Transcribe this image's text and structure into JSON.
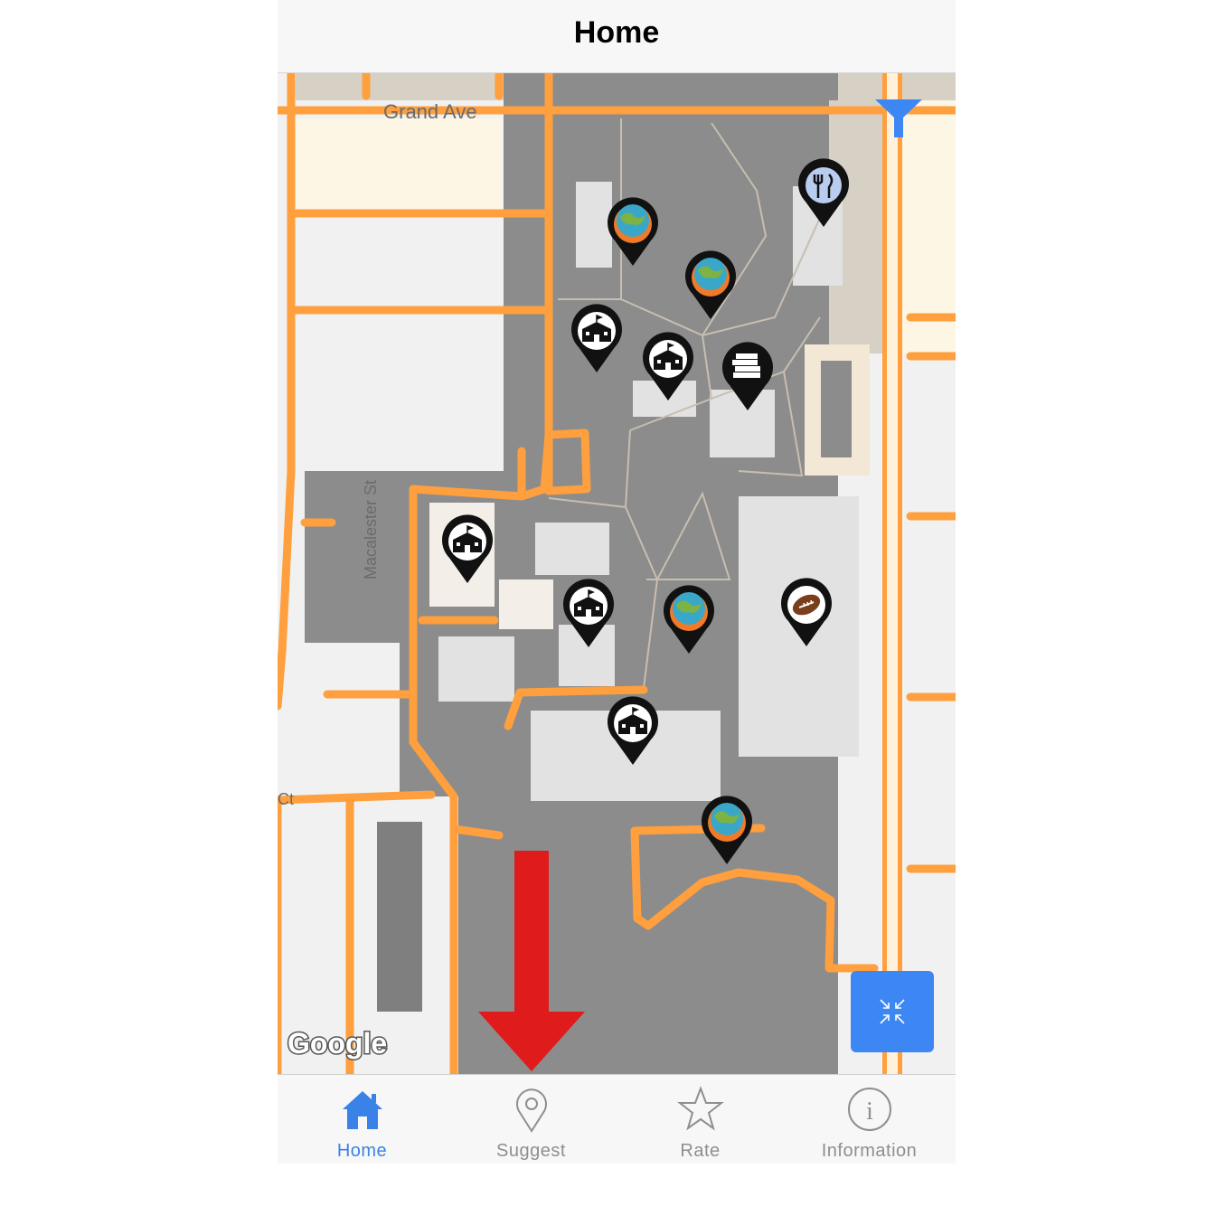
{
  "navbar": {
    "title": "Home"
  },
  "map": {
    "street_labels": {
      "grand_ave": "Grand Ave",
      "macalester_st": "Macalester St",
      "ct": "Ct"
    },
    "attribution": "Google",
    "pins": [
      {
        "type": "dining",
        "icon": "fork-knife-icon"
      },
      {
        "type": "globe",
        "icon": "globe-icon"
      },
      {
        "type": "globe",
        "icon": "globe-icon"
      },
      {
        "type": "building",
        "icon": "school-building-icon"
      },
      {
        "type": "building",
        "icon": "school-building-icon"
      },
      {
        "type": "library",
        "icon": "books-icon"
      },
      {
        "type": "building",
        "icon": "school-building-icon"
      },
      {
        "type": "building",
        "icon": "school-building-icon"
      },
      {
        "type": "globe",
        "icon": "globe-icon"
      },
      {
        "type": "athletics",
        "icon": "football-icon"
      },
      {
        "type": "building",
        "icon": "school-building-icon"
      },
      {
        "type": "globe",
        "icon": "globe-icon"
      }
    ],
    "filter_icon": "funnel-icon",
    "recenter_icon": "collapse-arrows-icon",
    "annotation_arrow_color": "#e01b1b"
  },
  "tabs": [
    {
      "label": "Home",
      "icon": "house-icon",
      "active": true
    },
    {
      "label": "Suggest",
      "icon": "map-pin-outline-icon",
      "active": false
    },
    {
      "label": "Rate",
      "icon": "star-outline-icon",
      "active": false
    },
    {
      "label": "Information",
      "icon": "info-circle-icon",
      "active": false
    }
  ],
  "colors": {
    "accent": "#3b82e8",
    "inactive": "#8e8e93",
    "road": "#ff9f3d",
    "campus": "#8c8c8c"
  }
}
